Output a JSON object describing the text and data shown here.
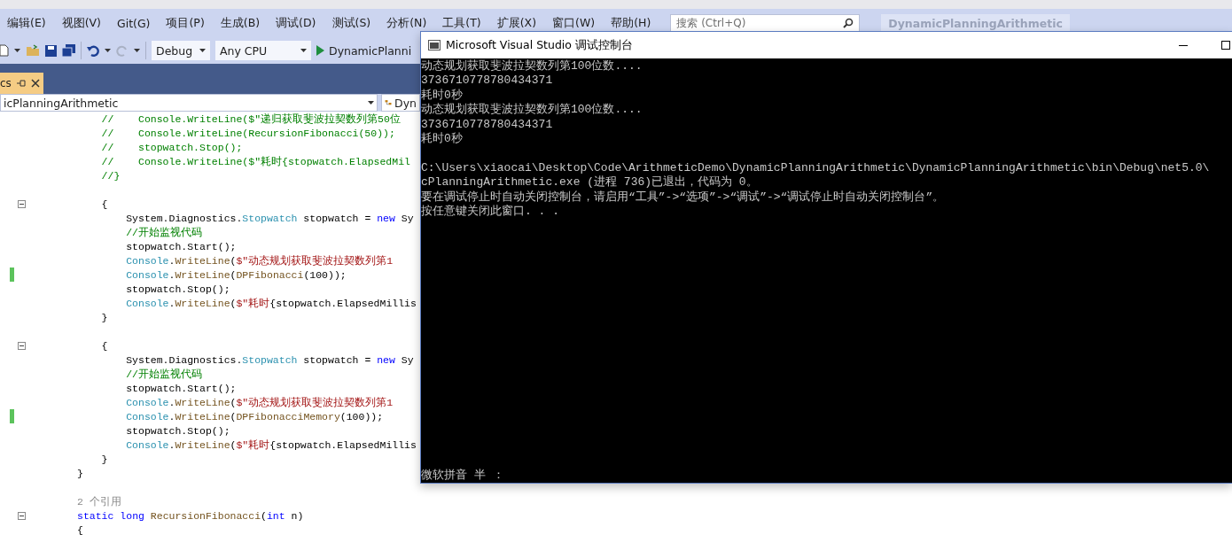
{
  "menu": [
    "编辑(E)",
    "视图(V)",
    "Git(G)",
    "项目(P)",
    "生成(B)",
    "调试(D)",
    "测试(S)",
    "分析(N)",
    "工具(T)",
    "扩展(X)",
    "窗口(W)",
    "帮助(H)"
  ],
  "search": {
    "placeholder": "搜索 (Ctrl+Q)"
  },
  "solution_title": "DynamicPlanningArithmetic",
  "toolbar": {
    "configuration": "Debug",
    "platform": "Any CPU",
    "start_target": "DynamicPlanni"
  },
  "document_tab": {
    "label": "cs"
  },
  "nav_bar": {
    "project": "icPlanningArithmetic",
    "member": "Dyn"
  },
  "code_lines": [
    {
      "kind": "code",
      "fold": false,
      "changed": false,
      "tokens": [
        {
          "kind": "comment",
          "text": "    //    Console.WriteLine($\"递归获取斐波拉契数列第50位"
        }
      ]
    },
    {
      "kind": "code",
      "fold": false,
      "changed": false,
      "tokens": [
        {
          "kind": "comment",
          "text": "    //    Console.WriteLine(RecursionFibonacci(50));"
        }
      ]
    },
    {
      "kind": "code",
      "fold": false,
      "changed": false,
      "tokens": [
        {
          "kind": "comment",
          "text": "    //    stopwatch.Stop();"
        }
      ]
    },
    {
      "kind": "code",
      "fold": false,
      "changed": false,
      "tokens": [
        {
          "kind": "comment",
          "text": "    //    Console.WriteLine($\"耗时{stopwatch.ElapsedMil"
        }
      ]
    },
    {
      "kind": "code",
      "fold": false,
      "changed": false,
      "tokens": [
        {
          "kind": "comment",
          "text": "    //}"
        }
      ]
    },
    {
      "kind": "blank",
      "fold": false,
      "changed": false
    },
    {
      "kind": "code",
      "fold": true,
      "changed": false,
      "tokens": [
        {
          "kind": "plain",
          "text": "    {"
        }
      ]
    },
    {
      "kind": "code",
      "fold": false,
      "changed": false,
      "tokens": [
        {
          "kind": "plain",
          "text": "        System.Diagnostics."
        },
        {
          "kind": "type",
          "text": "Stopwatch"
        },
        {
          "kind": "plain",
          "text": " stopwatch = "
        },
        {
          "kind": "keyword",
          "text": "new"
        },
        {
          "kind": "plain",
          "text": " Sy"
        }
      ]
    },
    {
      "kind": "code",
      "fold": false,
      "changed": false,
      "tokens": [
        {
          "kind": "comment",
          "text": "        //开始监视代码"
        }
      ]
    },
    {
      "kind": "code",
      "fold": false,
      "changed": false,
      "tokens": [
        {
          "kind": "plain",
          "text": "        stopwatch.Start();"
        }
      ]
    },
    {
      "kind": "code",
      "fold": false,
      "changed": false,
      "tokens": [
        {
          "kind": "type",
          "text": "        Console"
        },
        {
          "kind": "plain",
          "text": "."
        },
        {
          "kind": "method",
          "text": "WriteLine"
        },
        {
          "kind": "plain",
          "text": "("
        },
        {
          "kind": "string",
          "text": "$\"动态规划获取斐波拉契数列第1"
        }
      ]
    },
    {
      "kind": "code",
      "fold": false,
      "changed": true,
      "tokens": [
        {
          "kind": "type",
          "text": "        Console"
        },
        {
          "kind": "plain",
          "text": "."
        },
        {
          "kind": "method",
          "text": "WriteLine"
        },
        {
          "kind": "plain",
          "text": "("
        },
        {
          "kind": "method",
          "text": "DPFibonacci"
        },
        {
          "kind": "plain",
          "text": "(100));"
        }
      ]
    },
    {
      "kind": "code",
      "fold": false,
      "changed": false,
      "tokens": [
        {
          "kind": "plain",
          "text": "        stopwatch.Stop();"
        }
      ]
    },
    {
      "kind": "code",
      "fold": false,
      "changed": false,
      "tokens": [
        {
          "kind": "type",
          "text": "        Console"
        },
        {
          "kind": "plain",
          "text": "."
        },
        {
          "kind": "method",
          "text": "WriteLine"
        },
        {
          "kind": "plain",
          "text": "("
        },
        {
          "kind": "string",
          "text": "$\"耗时"
        },
        {
          "kind": "plain",
          "text": "{stopwatch.ElapsedMillis"
        }
      ]
    },
    {
      "kind": "code",
      "fold": false,
      "changed": false,
      "tokens": [
        {
          "kind": "plain",
          "text": "    }"
        }
      ]
    },
    {
      "kind": "blank",
      "fold": false,
      "changed": false
    },
    {
      "kind": "code",
      "fold": true,
      "changed": false,
      "tokens": [
        {
          "kind": "plain",
          "text": "    {"
        }
      ]
    },
    {
      "kind": "code",
      "fold": false,
      "changed": false,
      "tokens": [
        {
          "kind": "plain",
          "text": "        System.Diagnostics."
        },
        {
          "kind": "type",
          "text": "Stopwatch"
        },
        {
          "kind": "plain",
          "text": " stopwatch = "
        },
        {
          "kind": "keyword",
          "text": "new"
        },
        {
          "kind": "plain",
          "text": " Sy"
        }
      ]
    },
    {
      "kind": "code",
      "fold": false,
      "changed": false,
      "tokens": [
        {
          "kind": "comment",
          "text": "        //开始监视代码"
        }
      ]
    },
    {
      "kind": "code",
      "fold": false,
      "changed": false,
      "tokens": [
        {
          "kind": "plain",
          "text": "        stopwatch.Start();"
        }
      ]
    },
    {
      "kind": "code",
      "fold": false,
      "changed": false,
      "tokens": [
        {
          "kind": "type",
          "text": "        Console"
        },
        {
          "kind": "plain",
          "text": "."
        },
        {
          "kind": "method",
          "text": "WriteLine"
        },
        {
          "kind": "plain",
          "text": "("
        },
        {
          "kind": "string",
          "text": "$\"动态规划获取斐波拉契数列第1"
        }
      ]
    },
    {
      "kind": "code",
      "fold": false,
      "changed": true,
      "tokens": [
        {
          "kind": "type",
          "text": "        Console"
        },
        {
          "kind": "plain",
          "text": "."
        },
        {
          "kind": "method",
          "text": "WriteLine"
        },
        {
          "kind": "plain",
          "text": "("
        },
        {
          "kind": "method",
          "text": "DPFibonacciMemory"
        },
        {
          "kind": "plain",
          "text": "(100));"
        }
      ]
    },
    {
      "kind": "code",
      "fold": false,
      "changed": false,
      "tokens": [
        {
          "kind": "plain",
          "text": "        stopwatch.Stop();"
        }
      ]
    },
    {
      "kind": "code",
      "fold": false,
      "changed": false,
      "tokens": [
        {
          "kind": "type",
          "text": "        Console"
        },
        {
          "kind": "plain",
          "text": "."
        },
        {
          "kind": "method",
          "text": "WriteLine"
        },
        {
          "kind": "plain",
          "text": "("
        },
        {
          "kind": "string",
          "text": "$\"耗时"
        },
        {
          "kind": "plain",
          "text": "{stopwatch.ElapsedMillis"
        }
      ]
    },
    {
      "kind": "code",
      "fold": false,
      "changed": false,
      "tokens": [
        {
          "kind": "plain",
          "text": "    }"
        }
      ]
    },
    {
      "kind": "code",
      "fold": false,
      "changed": false,
      "tokens": [
        {
          "kind": "plain",
          "text": "}"
        }
      ]
    },
    {
      "kind": "blank",
      "fold": false,
      "changed": false
    },
    {
      "kind": "codelens",
      "fold": false,
      "changed": false,
      "text": "2 个引用"
    },
    {
      "kind": "code",
      "fold": true,
      "changed": false,
      "tokens": [
        {
          "kind": "keyword",
          "text": "static"
        },
        {
          "kind": "keyword",
          "text": " long"
        },
        {
          "kind": "method",
          "text": " RecursionFibonacci"
        },
        {
          "kind": "plain",
          "text": "("
        },
        {
          "kind": "keyword",
          "text": "int"
        },
        {
          "kind": "plain",
          "text": " n)"
        }
      ]
    },
    {
      "kind": "code",
      "fold": false,
      "changed": false,
      "tokens": [
        {
          "kind": "plain",
          "text": "{"
        }
      ]
    }
  ],
  "console": {
    "title": "Microsoft Visual Studio 调试控制台",
    "lines": [
      {
        "kind": "text",
        "text": "动态规划获取斐波拉契数列第100位数...."
      },
      {
        "kind": "text",
        "text": "3736710778780434371"
      },
      {
        "kind": "text",
        "text": "耗时0秒"
      },
      {
        "kind": "text",
        "text": "动态规划获取斐波拉契数列第100位数...."
      },
      {
        "kind": "text",
        "text": "3736710778780434371"
      },
      {
        "kind": "text",
        "text": "耗时0秒"
      },
      {
        "kind": "blank"
      },
      {
        "kind": "text",
        "text": "C:\\Users\\xiaocai\\Desktop\\Code\\ArithmeticDemo\\DynamicPlanningArithmetic\\DynamicPlanningArithmetic\\bin\\Debug\\net5.0\\"
      },
      {
        "kind": "text",
        "text": "cPlanningArithmetic.exe (进程 736)已退出，代码为 0。"
      },
      {
        "kind": "text",
        "text": "要在调试停止时自动关闭控制台，请启用“工具”->“选项”->“调试”->“调试停止时自动关闭控制台”。"
      },
      {
        "kind": "text",
        "text": "按任意键关闭此窗口. . ."
      }
    ],
    "ime_status": "微软拼音 半 ："
  }
}
